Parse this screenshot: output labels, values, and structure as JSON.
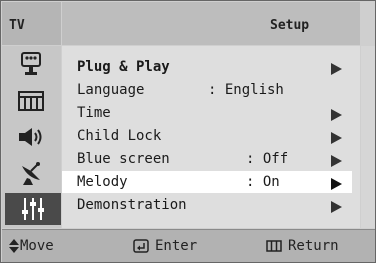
{
  "header": {
    "source_label": "TV",
    "title": "Setup"
  },
  "sidebar": {
    "icons": [
      "picture-icon",
      "sound-icon-film",
      "speaker-icon",
      "antenna-icon",
      "setup-sliders-icon"
    ],
    "selected": "setup-sliders-icon"
  },
  "menu": {
    "items": [
      {
        "label": "Plug & Play",
        "value": "",
        "arrow": true,
        "bold": true,
        "selected": false
      },
      {
        "label": "Language",
        "value": ": English",
        "arrow": false,
        "bold": false,
        "selected": false
      },
      {
        "label": "Time",
        "value": "",
        "arrow": true,
        "bold": false,
        "selected": false
      },
      {
        "label": "Child Lock",
        "value": "",
        "arrow": true,
        "bold": false,
        "selected": false
      },
      {
        "label": "Blue screen",
        "value": ": Off",
        "arrow": true,
        "bold": false,
        "selected": false
      },
      {
        "label": "Melody",
        "value": ": On",
        "arrow": true,
        "bold": false,
        "selected": true
      },
      {
        "label": "Demonstration",
        "value": "",
        "arrow": true,
        "bold": false,
        "selected": false
      }
    ]
  },
  "footer": {
    "move_label": "Move",
    "enter_label": "Enter",
    "return_label": "Return"
  }
}
